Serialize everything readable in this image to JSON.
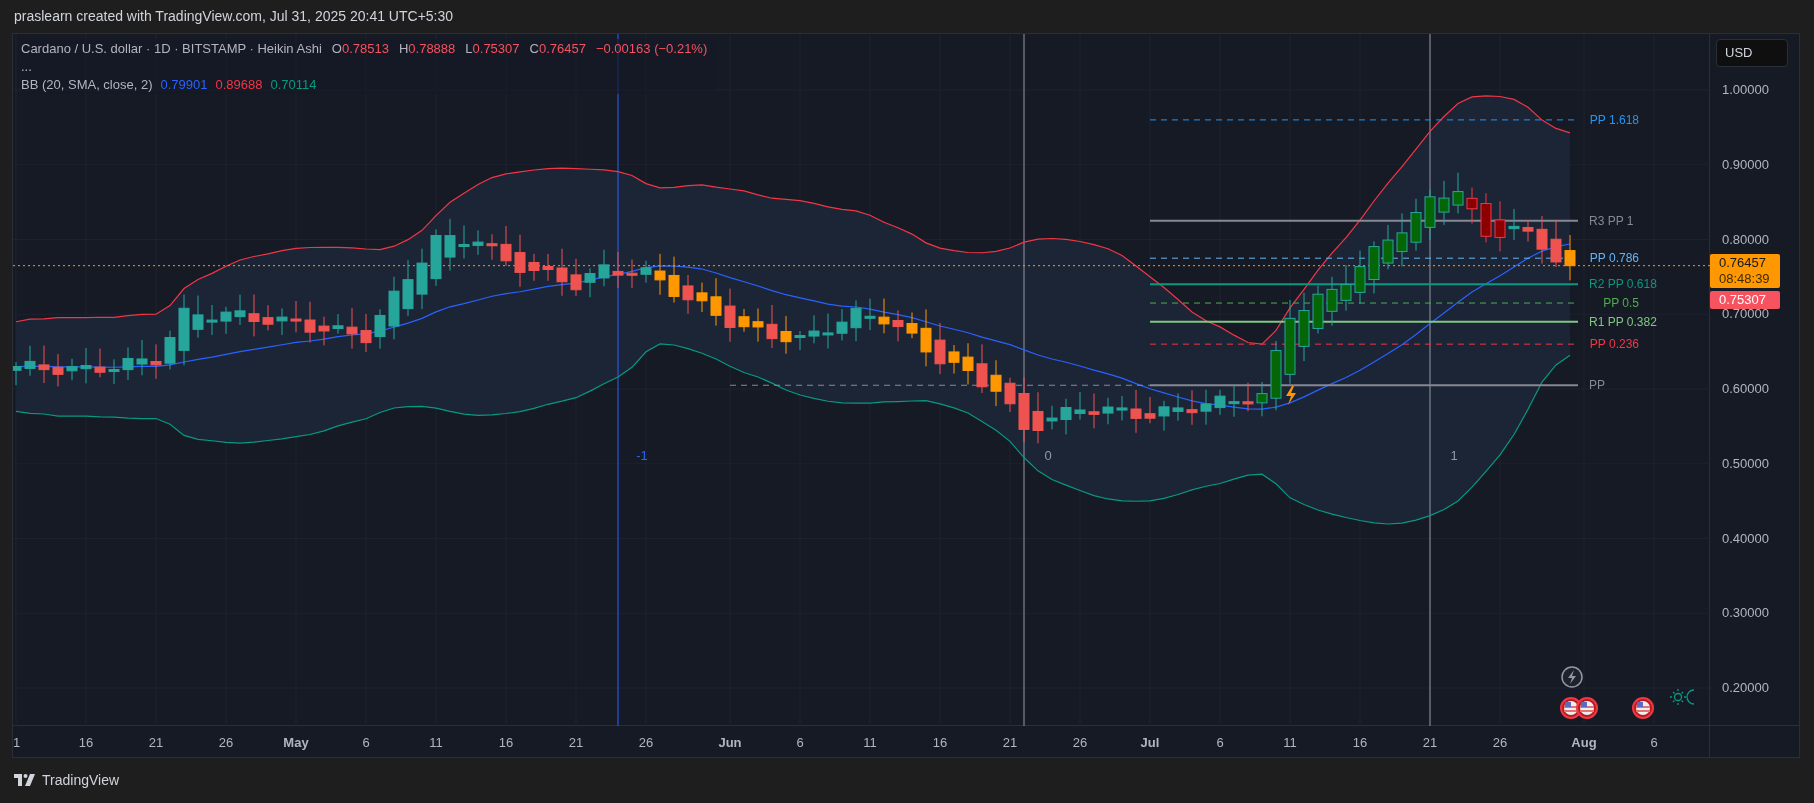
{
  "attribution": "praslearn created with TradingView.com, Jul 31, 2025 20:41 UTC+5:30",
  "legend": {
    "symbol": "Cardano / U.S. dollar · 1D · BITSTAMP · Heikin Ashi",
    "ohlc": [
      {
        "label": "O",
        "value": "0.78513"
      },
      {
        "label": "H",
        "value": "0.78888"
      },
      {
        "label": "L",
        "value": "0.75307"
      },
      {
        "label": "C",
        "value": "0.76457"
      }
    ],
    "change": "−0.00163 (−0.21%)",
    "more": "..."
  },
  "indicator": {
    "name": "BB (20, SMA, close, 2)",
    "values": [
      {
        "text": "0.79901",
        "color": "#2962ff"
      },
      {
        "text": "0.89688",
        "color": "#f23645"
      },
      {
        "text": "0.70114",
        "color": "#089981"
      }
    ]
  },
  "currency_button": "USD",
  "price_axis": [
    "1.00000",
    "0.90000",
    "0.80000",
    "0.70000",
    "0.60000",
    "0.50000",
    "0.40000",
    "0.30000",
    "0.20000"
  ],
  "price_tags": [
    {
      "kind": "last",
      "value": "0.76457",
      "countdown": "08:48:39",
      "color": "#ff9800"
    },
    {
      "kind": "low",
      "value": "0.75307",
      "color": "#f7525f"
    }
  ],
  "date_axis": [
    {
      "label": "1",
      "bold": false
    },
    {
      "label": "16",
      "bold": false
    },
    {
      "label": "21",
      "bold": false
    },
    {
      "label": "26",
      "bold": false
    },
    {
      "label": "May",
      "bold": true
    },
    {
      "label": "6",
      "bold": false
    },
    {
      "label": "11",
      "bold": false
    },
    {
      "label": "16",
      "bold": false
    },
    {
      "label": "21",
      "bold": false
    },
    {
      "label": "26",
      "bold": false
    },
    {
      "label": "Jun",
      "bold": true
    },
    {
      "label": "6",
      "bold": false
    },
    {
      "label": "11",
      "bold": false
    },
    {
      "label": "16",
      "bold": false
    },
    {
      "label": "21",
      "bold": false
    },
    {
      "label": "26",
      "bold": false
    },
    {
      "label": "Jul",
      "bold": true
    },
    {
      "label": "6",
      "bold": false
    },
    {
      "label": "11",
      "bold": false
    },
    {
      "label": "16",
      "bold": false
    },
    {
      "label": "21",
      "bold": false
    },
    {
      "label": "26",
      "bold": false
    },
    {
      "label": "Aug",
      "bold": true
    },
    {
      "label": "6",
      "bold": false
    }
  ],
  "pivot_levels": [
    {
      "label": "PP 1.618",
      "color": "#2196f3",
      "kind": "dashed"
    },
    {
      "label": "R3 PP 1",
      "color": "#868993",
      "kind": "solid"
    },
    {
      "label": "PP 0.786",
      "color": "#64b5f6",
      "kind": "dashed"
    },
    {
      "label": "R2 PP 0.618",
      "color": "#089981",
      "kind": "solid"
    },
    {
      "label": "PP 0.5",
      "color": "#4caf50",
      "kind": "dashed"
    },
    {
      "label": "R1 PP 0.382",
      "color": "#81c784",
      "kind": "solid"
    },
    {
      "label": "PP 0.236",
      "color": "#f23645",
      "kind": "dashed"
    },
    {
      "label": "PP",
      "color": "#868993",
      "kind": "solid"
    }
  ],
  "cycle_markers": [
    {
      "label": "-1",
      "color": "#2962ff"
    },
    {
      "label": "0",
      "color": "#9598a1"
    },
    {
      "label": "1",
      "color": "#9598a1"
    }
  ],
  "footer": {
    "logo_text": "TradingView"
  }
}
